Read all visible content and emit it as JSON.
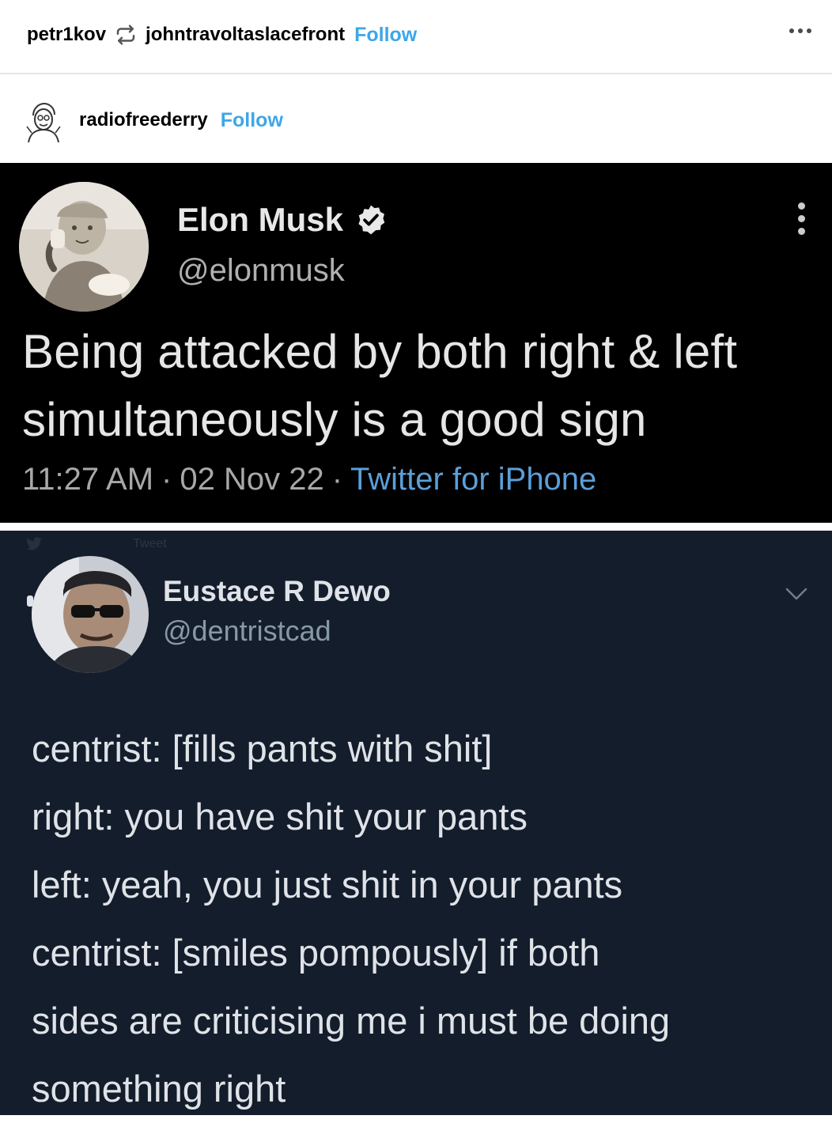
{
  "reblog": {
    "reblogger": "petr1kov",
    "original_poster": "johntravoltaslacefront",
    "follow_label": "Follow"
  },
  "source": {
    "username": "radiofreederry",
    "follow_label": "Follow"
  },
  "tweet1": {
    "name": "Elon Musk",
    "handle": "@elonmusk",
    "text": "Being attacked by both right & left simultaneously is a good sign",
    "time": "11:27 AM",
    "date": "02 Nov 22",
    "separator": "·",
    "source": "Twitter for iPhone"
  },
  "tweet2": {
    "faded_label": "Tweet",
    "name": "Eustace R Dewo",
    "handle": "@dentristcad",
    "lines": [
      "centrist: [fills pants with shit]",
      "right: you have shit your pants",
      "left: yeah, you just shit in your pants",
      "centrist: [smiles pompously] if both",
      "sides are criticising me i must be doing",
      "something right"
    ]
  },
  "colors": {
    "follow": "#3ea6e8",
    "tweet1_bg": "#000000",
    "tweet2_bg": "#141d2b",
    "twitter_source": "#5b9fd8"
  }
}
